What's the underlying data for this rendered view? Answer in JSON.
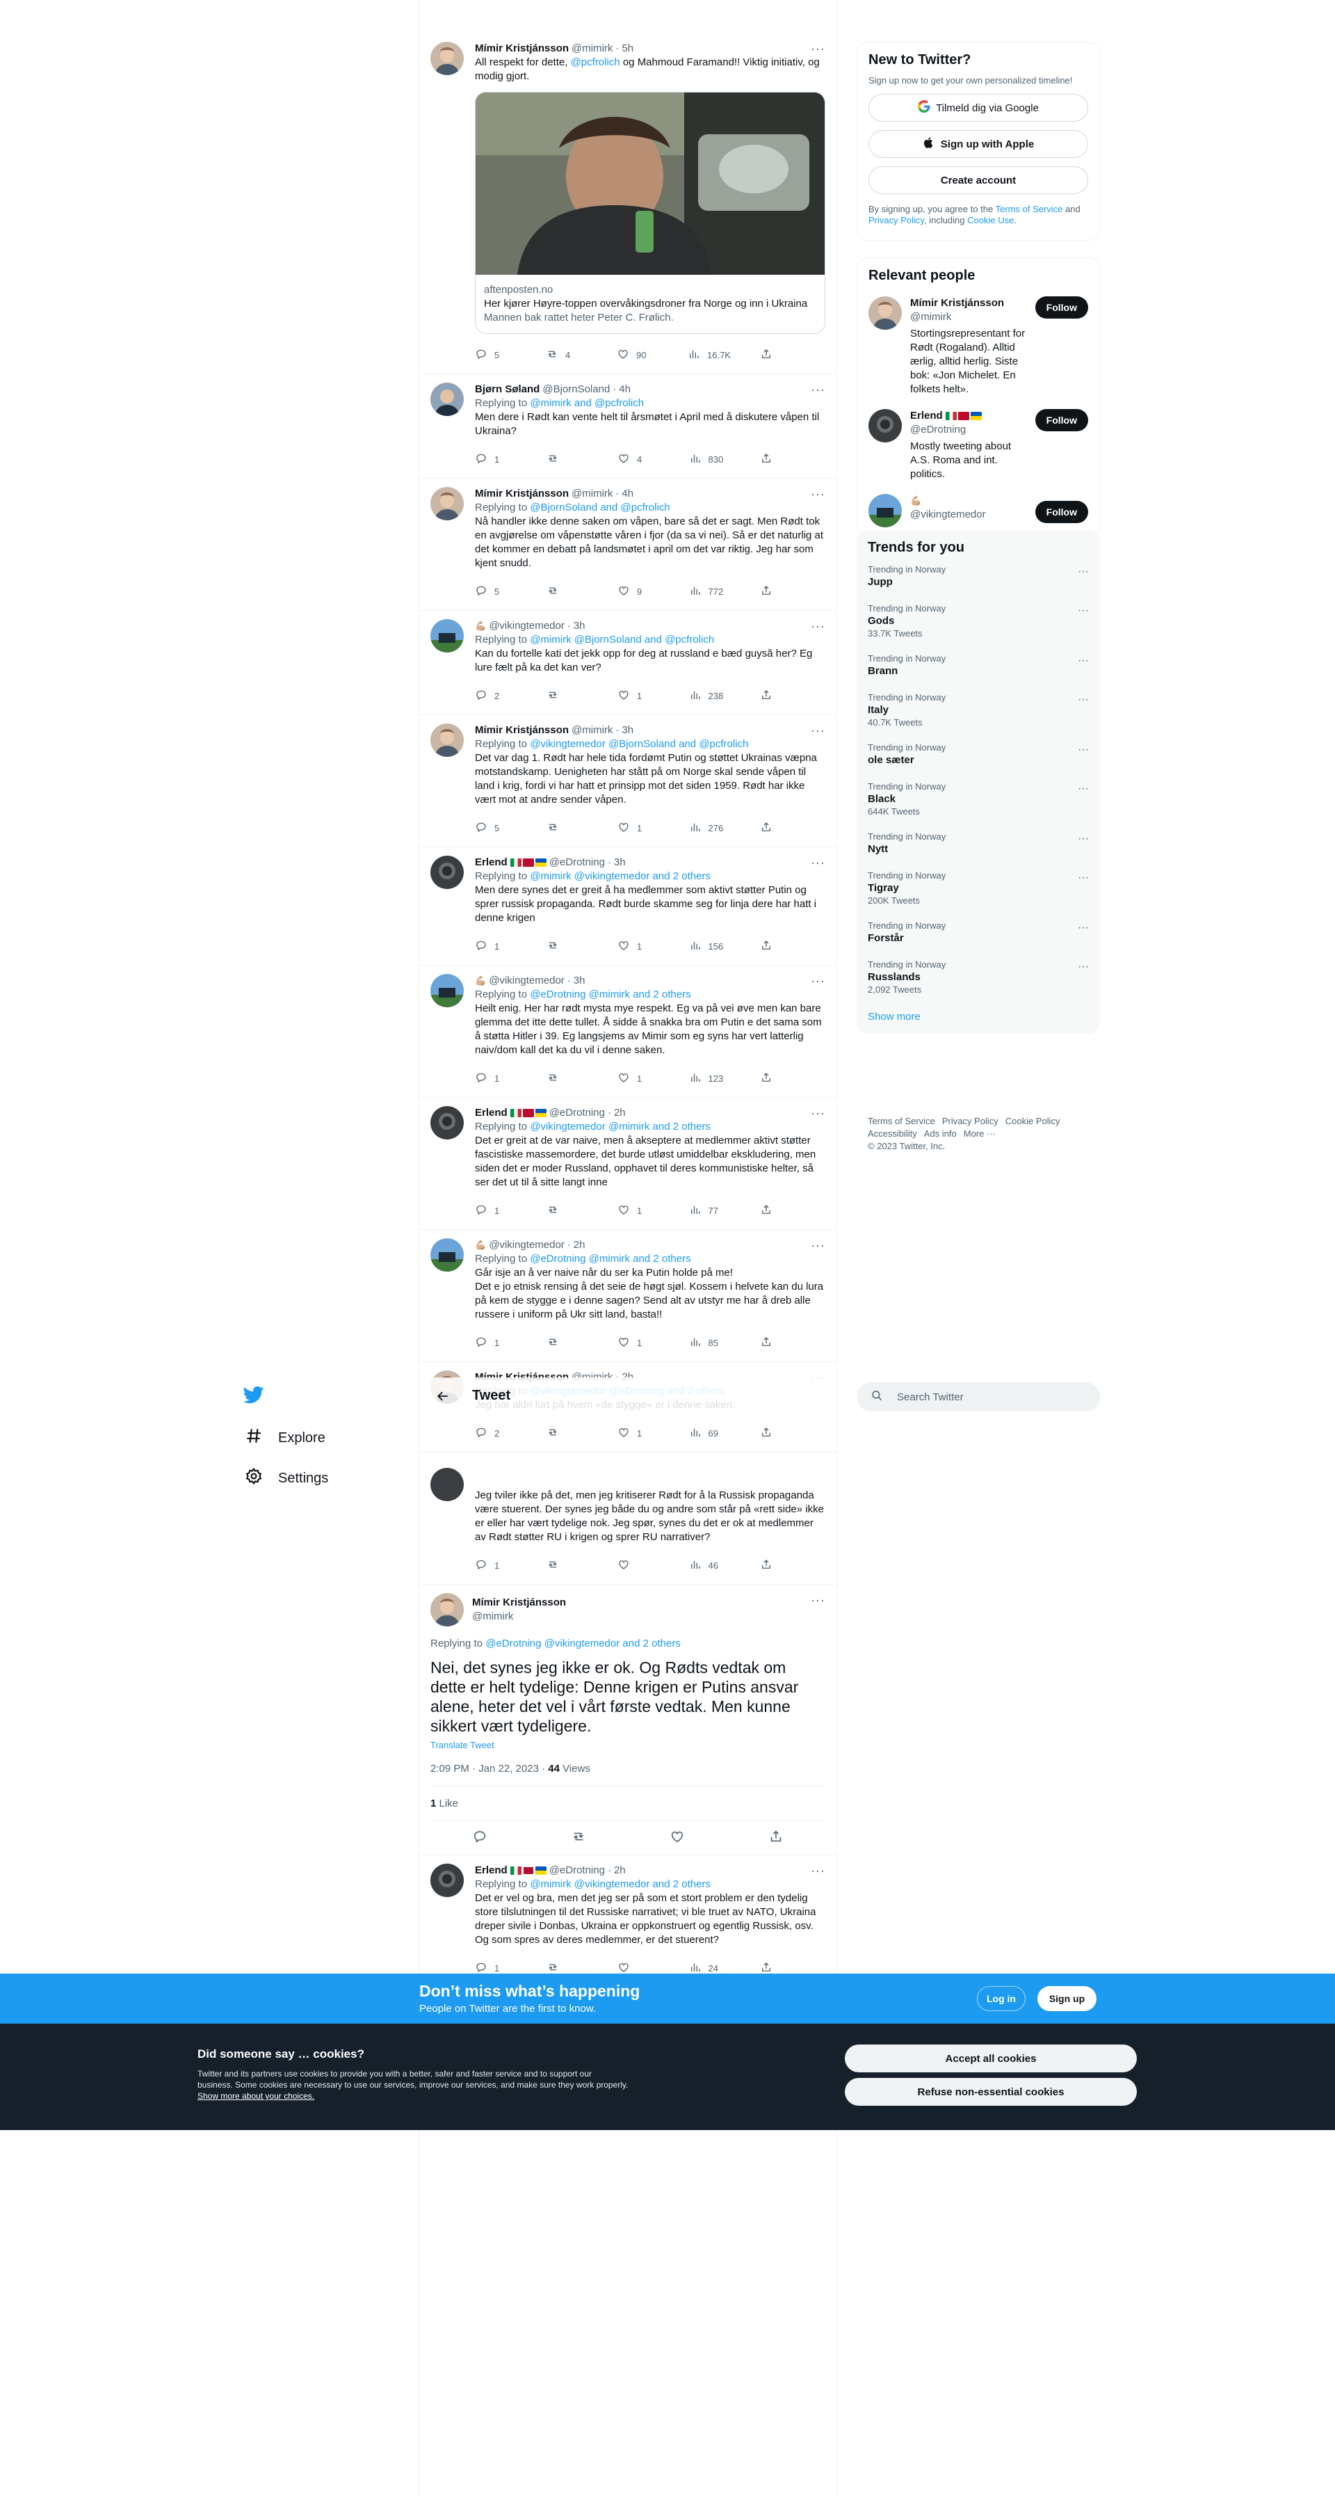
{
  "nav": {
    "items": [
      {
        "label": "Explore",
        "icon": "hashtag-icon"
      },
      {
        "label": "Settings",
        "icon": "gear-icon"
      }
    ]
  },
  "header": {
    "title": "Tweet"
  },
  "tweets": [
    {
      "name": "Mímir Kristjánsson",
      "handle": "@mimirk",
      "time": "5h",
      "text_parts": [
        "All respekt for dette, ",
        "@pcfrolich",
        " og Mahmoud Faramand!! Viktig initiativ, og modig gjort."
      ],
      "card": {
        "domain": "aftenposten.no",
        "title": "Her kjører Høyre-toppen overvåkingsdroner fra Norge og inn i Ukraina",
        "desc": "Mannen bak rattet heter Peter C. Frølich."
      },
      "replies": "5",
      "retweets": "4",
      "likes": "90",
      "views": "16.7K"
    },
    {
      "name": "Bjørn Søland",
      "handle": "@BjornSoland",
      "time": "4h",
      "reply_to": "@mimirk and @pcfrolich",
      "text": "Men dere i Rødt kan vente helt til årsmøtet i April med å diskutere våpen til Ukraina?",
      "replies": "1",
      "retweets": "",
      "likes": "4",
      "views": "830"
    },
    {
      "name": "Mímir Kristjánsson",
      "handle": "@mimirk",
      "time": "4h",
      "reply_to": "@BjornSoland and @pcfrolich",
      "text": "Nå handler ikke denne saken om våpen, bare så det er sagt. Men Rødt tok en avgjørelse om våpenstøtte våren i fjor (da sa vi nei). Så er det naturlig at det kommer en debatt på landsmøtet i april om det var riktig. Jeg har som kjent snudd.",
      "replies": "5",
      "retweets": "",
      "likes": "9",
      "views": "772"
    },
    {
      "name": "",
      "handle": "@vikingtemedor",
      "time": "3h",
      "reply_to": "@mimirk @BjornSoland and @pcfrolich",
      "text": "Kan du fortelle kati det jekk opp for deg at russland e bæd guysă her? Eg lure fælt på ka det kan ver?",
      "replies": "2",
      "retweets": "",
      "likes": "1",
      "views": "238"
    },
    {
      "name": "Mímir Kristjánsson",
      "handle": "@mimirk",
      "time": "3h",
      "reply_to": "@vikingtemedor @BjornSoland and @pcfrolich",
      "text": "Det var dag 1. Rødt har hele tida fordømt Putin og støttet Ukrainas væpna motstandskamp. Uenigheten har stått på om Norge skal sende våpen til land i krig, fordi vi har hatt et prinsipp mot det siden 1959. Rødt har ikke vært mot at andre sender våpen.",
      "replies": "5",
      "retweets": "",
      "likes": "1",
      "views": "276"
    },
    {
      "name": "Erlend",
      "handle": "@eDrotning",
      "time": "3h",
      "reply_to": "@mimirk @vikingtemedor and 2 others",
      "text": "Men dere synes det er greit å ha medlemmer som aktivt støtter Putin og sprer russisk propaganda. Rødt burde skamme seg for linja dere har hatt i denne krigen",
      "replies": "1",
      "retweets": "",
      "likes": "1",
      "views": "156"
    },
    {
      "name": "",
      "handle": "@vikingtemedor",
      "time": "3h",
      "reply_to": "@eDrotning @mimirk and 2 others",
      "text": "Heilt enig. Her har rødt mysta mye respekt. Eg va på vei øve men kan bare glemma det itte dette tullet. Å sidde å snakka bra om Putin e det sama som å støtta Hitler i 39. Eg langsjems av Mimir som eg syns har vert latterlig naiv/dom kall det ka du vil i denne saken.",
      "replies": "1",
      "retweets": "",
      "likes": "1",
      "views": "123"
    },
    {
      "name": "Erlend",
      "handle": "@eDrotning",
      "time": "2h",
      "reply_to": "@vikingtemedor @mimirk and 2 others",
      "text": "Det er greit at de var naive, men å akseptere at medlemmer aktivt støtter fascistiske massemordere, det burde utløst umiddelbar ekskludering, men siden det er moder Russland, opphavet til deres kommunistiske helter, så ser det ut til å sitte langt inne",
      "replies": "1",
      "retweets": "",
      "likes": "1",
      "views": "77"
    },
    {
      "name": "",
      "handle": "@vikingtemedor",
      "time": "2h",
      "reply_to": "@eDrotning @mimirk and 2 others",
      "text": "Går isje an å ver naive når du ser ka Putin holde på me!\nDet e jo etnisk rensing å det seie de høgt sjøl. Kossem i helvete kan du lura på kem de stygge e i denne sagen? Send alt av utstyr me har å dreb alle russere i uniform på Ukr sitt land, basta!!",
      "replies": "1",
      "retweets": "",
      "likes": "1",
      "views": "85"
    },
    {
      "name": "Mímir Kristjánsson",
      "handle": "@mimirk",
      "time": "2h",
      "reply_to": "@vikingtemedor @eDrotning and 2 others",
      "text": "Jeg har aldri lurt på hvem «de stygge» er i denne saken.",
      "replies": "2",
      "retweets": "",
      "likes": "1",
      "views": "69"
    }
  ],
  "partial_tweet": {
    "text": "Jeg tviler ikke på det, men jeg kritiserer Rødt for å la Russisk propaganda være stuerent. Der synes jeg både du og andre som står på «rett side» ikke er eller har vært tydelige nok. Jeg spør, synes du det er ok at medlemmer av Rødt støtter RU i krigen og sprer RU narrativer?",
    "replies": "1",
    "retweets": "",
    "likes": "",
    "views": "46"
  },
  "focus": {
    "name": "Mímir Kristjánsson",
    "handle": "@mimirk",
    "reply_label": "Replying to ",
    "reply_to": "@eDrotning @vikingtemedor and 2 others",
    "text": "Nei, det synes jeg ikke er ok. Og Rødts vedtak om dette er helt tydelige: Denne krigen er Putins ansvar alene, heter det vel i vårt første vedtak. Men kunne sikkert vært tydeligere.",
    "translate": "Translate Tweet",
    "datetime": "2:09 PM · Jan 22, 2023 · ",
    "views_count": "44",
    "views_label": " Views",
    "likes_count": "1",
    "likes_label": " Like"
  },
  "last_reply": {
    "name": "Erlend",
    "handle": "@eDrotning",
    "time": "2h",
    "reply_to": "@mimirk @vikingtemedor and 2 others",
    "text": "Det er vel og bra, men det jeg ser på som et stort problem er den tydelig store tilslutningen til det Russiske narrativet; vi ble truet av NATO, Ukraina dreper sivile i Donbas, Ukraina er oppkonstruert og egentlig Russisk, osv. Og som spres av deres medlemmer, er det stuerent?",
    "replies": "1",
    "retweets": "",
    "likes": "",
    "views": "24"
  },
  "labels": {
    "replying_to": "Replying to "
  },
  "sidebar": {
    "new": {
      "title": "New to Twitter?",
      "sub": "Sign up now to get your own personalized timeline!",
      "google": "Tilmeld dig via Google",
      "apple": "Sign up with Apple",
      "create": "Create account",
      "terms_pre": "By signing up, you agree to the ",
      "terms_link": "Terms of Service",
      "terms_mid": " and ",
      "privacy_link": "Privacy Policy",
      "terms_mid2": ", including ",
      "cookie_link": "Cookie Use",
      "terms_end": "."
    },
    "relevant": {
      "title": "Relevant people",
      "follow": "Follow",
      "people": [
        {
          "name": "Mímir Kristjánsson",
          "handle": "@mimirk",
          "bio": "Stortingsrepresentant for Rødt (Rogaland). Alltid ærlig, alltid herlig. Siste bok: «Jon Michelet. En folkets helt»."
        },
        {
          "name": "Erlend",
          "handle": "@eDrotning",
          "bio": "Mostly tweeting about A.S. Roma and int. politics."
        },
        {
          "name": "",
          "handle": "@vikingtemedor",
          "bio": ""
        }
      ]
    },
    "trends": {
      "title": "Trends for you",
      "items": [
        {
          "ctx": "Trending in Norway",
          "name": "Jupp",
          "count": ""
        },
        {
          "ctx": "Trending in Norway",
          "name": "Gods",
          "count": "33.7K Tweets"
        },
        {
          "ctx": "Trending in Norway",
          "name": "Brann",
          "count": ""
        },
        {
          "ctx": "Trending in Norway",
          "name": "Italy",
          "count": "40.7K Tweets"
        },
        {
          "ctx": "Trending in Norway",
          "name": "ole sæter",
          "count": ""
        },
        {
          "ctx": "Trending in Norway",
          "name": "Black",
          "count": "644K Tweets"
        },
        {
          "ctx": "Trending in Norway",
          "name": "Nytt",
          "count": ""
        },
        {
          "ctx": "Trending in Norway",
          "name": "Tigray",
          "count": "200K Tweets"
        },
        {
          "ctx": "Trending in Norway",
          "name": "Forstår",
          "count": ""
        },
        {
          "ctx": "Trending in Norway",
          "name": "Russlands",
          "count": "2,092 Tweets"
        }
      ],
      "show_more": "Show more"
    },
    "footer": {
      "line1": [
        "Terms of Service",
        "Privacy Policy",
        "Cookie Policy"
      ],
      "line2": [
        "Accessibility",
        "Ads info",
        "More ···"
      ],
      "copyright": "© 2023 Twitter, Inc."
    },
    "search_placeholder": "Search Twitter"
  },
  "signup_bar": {
    "title": "Don’t miss what’s happening",
    "subtitle": "People on Twitter are the first to know.",
    "login": "Log in",
    "signup": "Sign up"
  },
  "cookies": {
    "title": "Did someone say … cookies?",
    "body": "Twitter and its partners use cookies to provide you with a better, safer and faster service and to support our business. Some cookies are necessary to use our services, improve our services, and make sure they work properly. ",
    "link": "Show more about your choices.",
    "accept": "Accept all cookies",
    "refuse": "Refuse non-essential cookies"
  },
  "colors": {
    "accent": "#1d9bf0",
    "dark": "#0f1419",
    "muted": "#536471",
    "cookie_bg": "#15202b"
  }
}
